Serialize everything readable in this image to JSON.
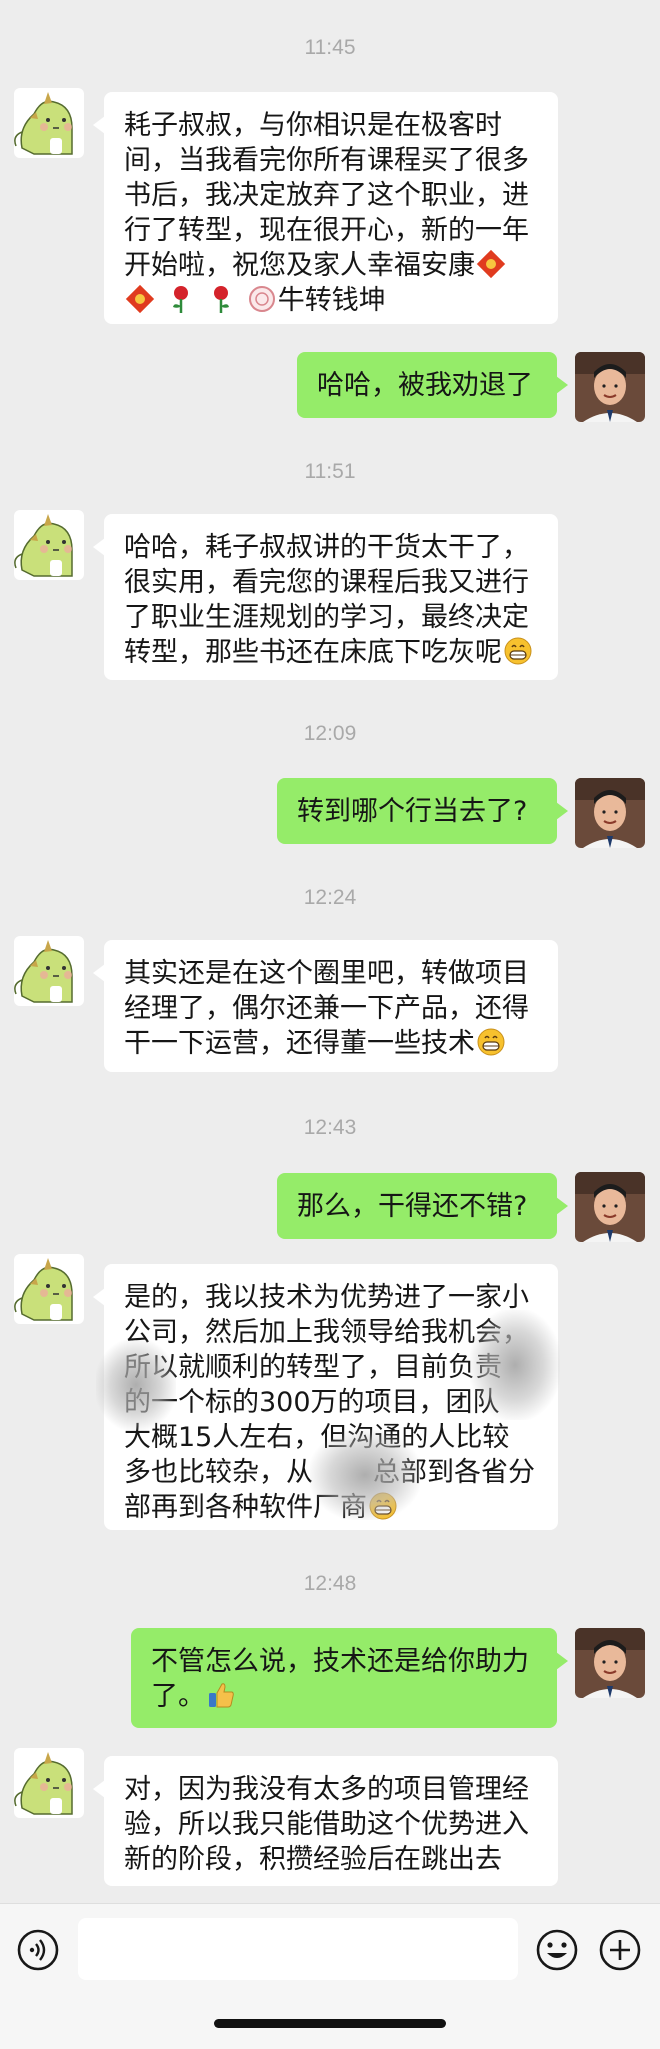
{
  "messages": [
    {
      "type": "time",
      "text": "11:45"
    },
    {
      "type": "in",
      "text": "耗子叔叔，与你相识是在极客时间，当我看完你所有课程买了很多书后，我决定放弃了这个职业，进行了转型，现在很开心，新的一年开始啦，祝您及家人幸福安康",
      "trail": "牛转钱坤"
    },
    {
      "type": "out",
      "text": "哈哈，被我劝退了"
    },
    {
      "type": "time",
      "text": "11:51"
    },
    {
      "type": "in",
      "text": "哈哈，耗子叔叔讲的干货太干了，很实用，看完您的课程后我又进行了职业生涯规划的学习，最终决定转型，那些书还在床底下吃灰呢"
    },
    {
      "type": "time",
      "text": "12:09"
    },
    {
      "type": "out",
      "text": "转到哪个行当去了?"
    },
    {
      "type": "time",
      "text": "12:24"
    },
    {
      "type": "in",
      "text": "其实还是在这个圈里吧，转做项目经理了，偶尔还兼一下产品，还得干一下运营，还得董一些技术"
    },
    {
      "type": "time",
      "text": "12:43"
    },
    {
      "type": "out",
      "text": "那么，干得还不错?"
    },
    {
      "type": "in",
      "line1": "是的，我以技术为优势进了一家小",
      "line2": "公司，然后加上我领导给我机会，",
      "line3": "所以就顺利的转型了，目前负责",
      "line4": "的一个标的300万的项目，团队",
      "line5": "大概15人左右，但沟通的人比较",
      "line6": "多也比较杂，从",
      "line6b": "总部到各省分",
      "line7": "部再到各种软件厂商"
    },
    {
      "type": "time",
      "text": "12:48"
    },
    {
      "type": "out",
      "text": "不管怎么说，技术还是给你助力了。"
    },
    {
      "type": "in",
      "text": "对，因为我没有太多的项目管理经验，所以我只能借助这个优势进入新的阶段，积攒经验后在跳出去"
    }
  ],
  "input": {
    "placeholder": ""
  },
  "colors": {
    "background": "#ededed",
    "incoming": "#ffffff",
    "outgoing": "#95ec69",
    "time": "#a9a9a9"
  },
  "icons": {
    "voice": "voice-icon",
    "emoji": "smiley-icon",
    "more": "plus-circle-icon"
  }
}
